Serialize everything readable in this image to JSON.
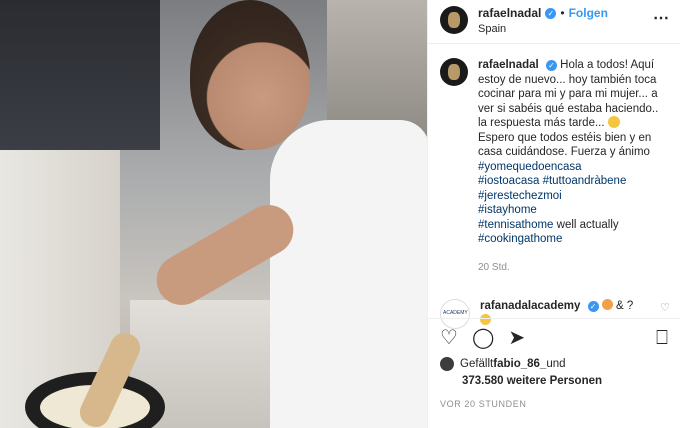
{
  "header": {
    "username": "rafaelnadal",
    "follow_label": "Folgen",
    "location": "Spain",
    "more_icon": "more-icon"
  },
  "caption": {
    "username": "rafaelnadal",
    "text": "Hola a todos! Aquí estoy de nuevo... hoy también toca cocinar para mi y para mi mujer... a ver si sabéis qué estaba haciendo.. la respuesta más tarde...",
    "text2": "Espero que todos estéis bien y en casa cuidándose. Fuerza y ánimo",
    "hashtags": [
      "#yomequedoencasa",
      "#iostoacasa #tuttoandràbene",
      "#jerestechezmoi",
      "#istayhome"
    ],
    "tennis_tag": "#tennisathome",
    "tennis_suffix": " well actually",
    "last_tag": "#cookingathome",
    "timestamp": "20 Std."
  },
  "comment": {
    "username": "rafanadalacademy",
    "text": " & ?"
  },
  "footer": {
    "liked_by_prefix": "Gefällt ",
    "liked_by_user": "fabio_86_",
    "liked_by_suffix": " und",
    "count": "373.580",
    "count_suffix": " weitere Personen",
    "ago": "VOR 20 STUNDEN"
  },
  "colors": {
    "accent": "#3897f0",
    "hashtag": "#00376b",
    "muted": "#8e8e8e"
  }
}
